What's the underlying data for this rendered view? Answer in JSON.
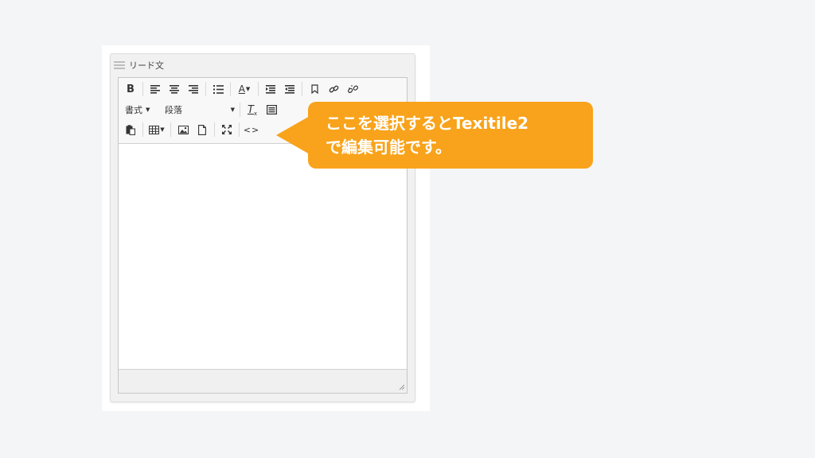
{
  "panel": {
    "title": "リード文"
  },
  "toolbar": {
    "bold_label": "B",
    "text_color_label": "A",
    "format_label": "書式",
    "paragraph_label": "段落",
    "clear_format_label": "T",
    "source_label": "<>"
  },
  "callout": {
    "line1": "ここを選択するとTexitile2",
    "line2": "で編集可能です。",
    "color": "#f8a31b"
  },
  "icons": [
    "align-left-icon",
    "align-center-icon",
    "align-right-icon",
    "bullet-list-icon",
    "text-color-icon",
    "indent-icon",
    "outdent-icon",
    "bookmark-icon",
    "link-icon",
    "unlink-icon",
    "clear-format-icon",
    "block-icon",
    "paste-icon",
    "table-icon",
    "image-icon",
    "document-icon",
    "fullscreen-icon",
    "source-code-icon",
    "resize-handle-icon"
  ]
}
